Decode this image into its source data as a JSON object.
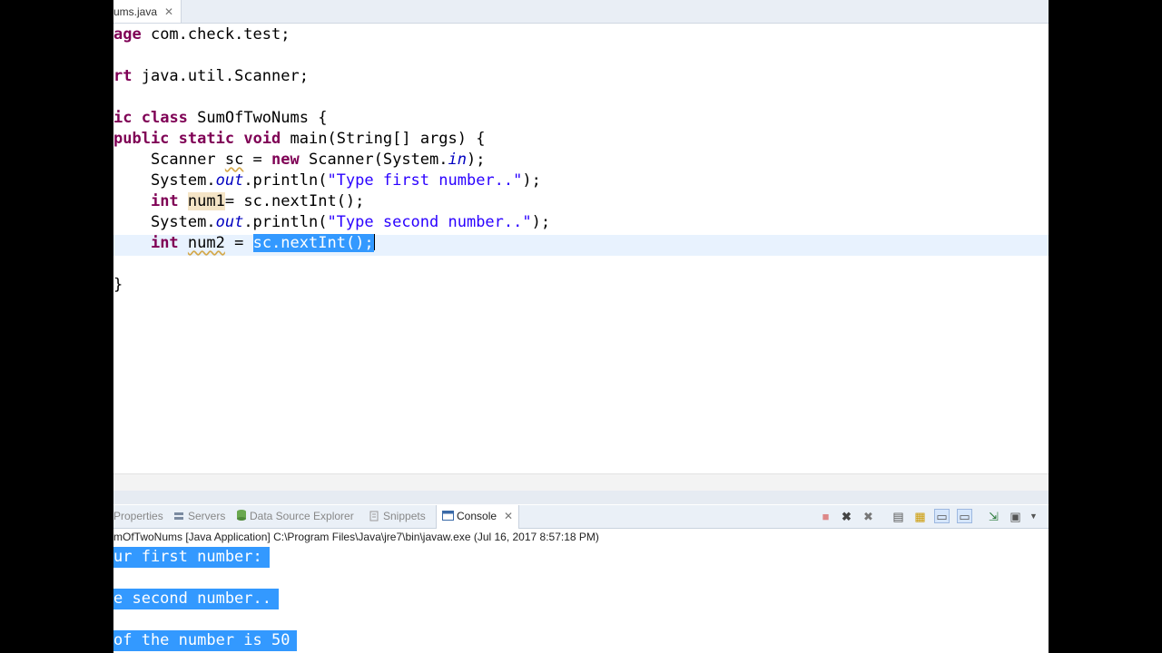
{
  "editor": {
    "tab_label": "ums.java",
    "lines": {
      "l1": {
        "kw": "age",
        "rest": " com.check.test;"
      },
      "l3": {
        "kw": "rt",
        "rest": " java.util.Scanner;"
      },
      "l5": {
        "kw1": "ic",
        "kw2": "class",
        "rest": " SumOfTwoNums {"
      },
      "l6": {
        "kw1": "public",
        "kw2": "static",
        "kw3": "void",
        "rest": " main(String[] args) {"
      },
      "l7": {
        "a": "    Scanner ",
        "b": "sc",
        "c": " = ",
        "kw": "new",
        "d": " Scanner(System.",
        "field": "in",
        "e": ");"
      },
      "l8": {
        "a": "    System.",
        "field": "out",
        "b": ".println(",
        "str": "\"Type first number..\"",
        "c": ");"
      },
      "l9": {
        "a": "    ",
        "kw": "int",
        "b": " ",
        "occ": "num1",
        "c": "= sc.nextInt();"
      },
      "l10": {
        "a": "    System.",
        "field": "out",
        "b": ".println(",
        "str": "\"Type second number..\"",
        "c": ");"
      },
      "l11": {
        "a": "    ",
        "kw": "int",
        "b": " ",
        "var": "num2",
        "c": " = ",
        "sel": "sc.nextInt();"
      },
      "l13": {
        "text": "}"
      }
    }
  },
  "panel": {
    "tabs": {
      "properties": "Properties",
      "servers": "Servers",
      "data_source": "Data Source Explorer",
      "snippets": "Snippets",
      "console": "Console"
    },
    "console_header": "mOfTwoNums [Java Application] C:\\Program Files\\Java\\jre7\\bin\\javaw.exe (Jul 16, 2017 8:57:18 PM)",
    "console_lines": {
      "c1": "ur first number:",
      "c2": "e second number..",
      "c3": "of the number is 50"
    }
  },
  "colors": {
    "keyword": "#7f0055",
    "string": "#2a00ff",
    "field": "#0000c0",
    "selection": "#3399ff",
    "current_line": "#e8f2fe"
  }
}
